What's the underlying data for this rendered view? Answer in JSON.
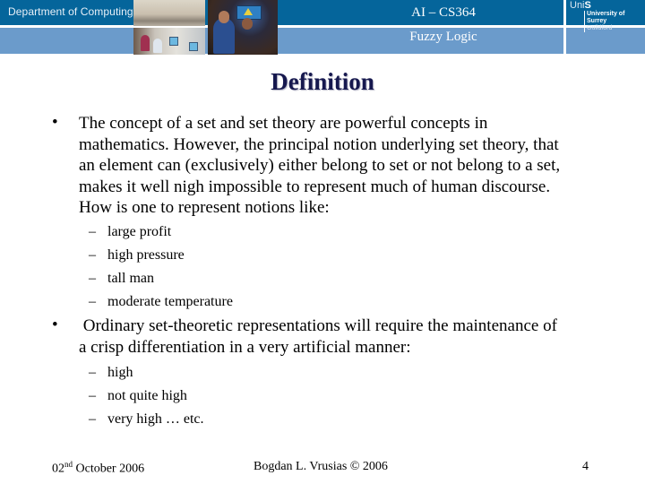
{
  "header": {
    "department": "Department of Computing",
    "course": "AI – CS364",
    "topic": "Fuzzy Logic",
    "logo": {
      "uni": "Uni",
      "s": "S",
      "name": "University of Surrey",
      "place": "Guildford"
    },
    "colors": {
      "dark_band": "#05659b",
      "light_band": "#6b9bcb",
      "title": "#16184e"
    }
  },
  "slide": {
    "title": "Definition",
    "bullet_glyph": "•",
    "dash_glyph": "–",
    "bullets": [
      {
        "text_lines": [
          "The concept of a set and set theory are powerful concepts in",
          "mathematics.  However, the principal notion underlying set theory, that",
          "an element can (exclusively) either belong to set or not belong to a set,",
          "makes it well nigh impossible to represent much of human discourse.",
          "How is one to represent notions like:"
        ],
        "sub_items": [
          "large profit",
          "high pressure",
          "tall man",
          "moderate temperature"
        ]
      },
      {
        "text_lines": [
          " Ordinary set-theoretic representations will require the maintenance of",
          "a crisp differentiation in a very artificial manner:"
        ],
        "sub_items": [
          "high",
          "not quite high",
          "very high … etc."
        ]
      }
    ]
  },
  "footer": {
    "date_prefix": "02",
    "date_sup": "nd",
    "date_rest": " October 2006",
    "author": "Bogdan L. Vrusias © 2006",
    "page": "4"
  }
}
